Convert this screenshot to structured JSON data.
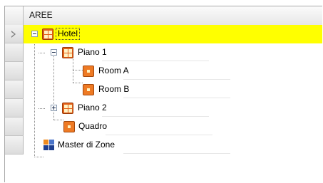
{
  "tree_grid": {
    "column_header": "AREE",
    "rows": [
      {
        "label": "Hotel",
        "selected": true,
        "expanded": true,
        "icon": "zone-grid-icon"
      },
      {
        "label": "Piano 1",
        "expanded": true,
        "icon": "zone-grid-icon"
      },
      {
        "label": "Room A",
        "icon": "room-icon"
      },
      {
        "label": "Room B",
        "icon": "room-icon"
      },
      {
        "label": "Piano 2",
        "expanded": false,
        "icon": "zone-grid-icon"
      },
      {
        "label": "Quadro",
        "icon": "room-icon"
      },
      {
        "label": "Master di Zone",
        "icon": "master-zones-icon"
      }
    ],
    "selected_row_color": "#ffff00",
    "zone_icon_color": "#e3611a",
    "room_icon_color": "#ee7a24"
  }
}
